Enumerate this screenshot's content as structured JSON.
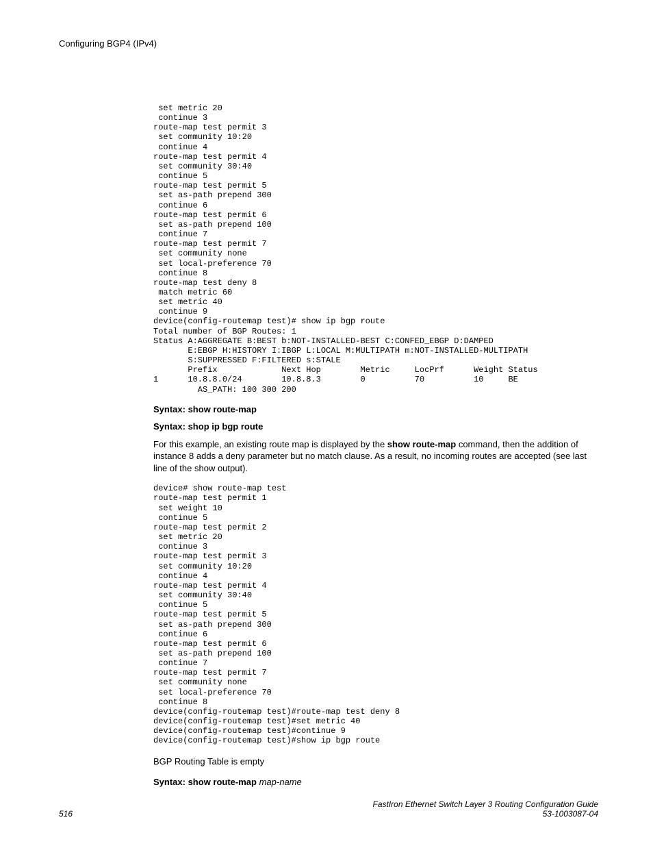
{
  "header": {
    "running_head": "Configuring BGP4 (IPv4)"
  },
  "code_block_1": " set metric 20\n continue 3\nroute-map test permit 3\n set community 10:20\n continue 4\nroute-map test permit 4\n set community 30:40\n continue 5\nroute-map test permit 5\n set as-path prepend 300\n continue 6\nroute-map test permit 6\n set as-path prepend 100\n continue 7\nroute-map test permit 7\n set community none\n set local-preference 70\n continue 8\nroute-map test deny 8\n match metric 60\n set metric 40\n continue 9\ndevice(config-routemap test)# show ip bgp route\nTotal number of BGP Routes: 1\nStatus A:AGGREGATE B:BEST b:NOT-INSTALLED-BEST C:CONFED_EBGP D:DAMPED\n       E:EBGP H:HISTORY I:IBGP L:LOCAL M:MULTIPATH m:NOT-INSTALLED-MULTIPATH\n       S:SUPPRESSED F:FILTERED s:STALE\n       Prefix             Next Hop        Metric     LocPrf      Weight Status\n1      10.8.8.0/24        10.8.8.3        0          70          10     BE\n         AS_PATH: 100 300 200",
  "syntax_1_label": "Syntax: ",
  "syntax_1_cmd": "show route-map",
  "syntax_2_label": "Syntax: ",
  "syntax_2_cmd": "shop ip bgp route",
  "para_1_pre": "For this example, an existing route map is displayed by the ",
  "para_1_bold": "show route-map",
  "para_1_post": " command, then the addition of instance 8 adds a deny parameter but no match clause. As a result, no incoming routes are accepted (see last line of the show output).",
  "code_block_2": "device# show route-map test\nroute-map test permit 1\n set weight 10\n continue 5\nroute-map test permit 2\n set metric 20\n continue 3\nroute-map test permit 3\n set community 10:20\n continue 4\nroute-map test permit 4\n set community 30:40\n continue 5\nroute-map test permit 5\n set as-path prepend 300\n continue 6\nroute-map test permit 6\n set as-path prepend 100\n continue 7\nroute-map test permit 7\n set community none\n set local-preference 70\n continue 8\ndevice(config-routemap test)#route-map test deny 8\ndevice(config-routemap test)#set metric 40\ndevice(config-routemap test)#continue 9\ndevice(config-routemap test)#show ip bgp route",
  "para_2": "BGP Routing Table is empty",
  "syntax_3_label": "Syntax: ",
  "syntax_3_cmd": "show route-map",
  "syntax_3_arg": " map-name",
  "footer": {
    "page_number": "516",
    "doc_title_line1": "FastIron Ethernet Switch Layer 3 Routing Configuration Guide",
    "doc_title_line2": "53-1003087-04"
  }
}
